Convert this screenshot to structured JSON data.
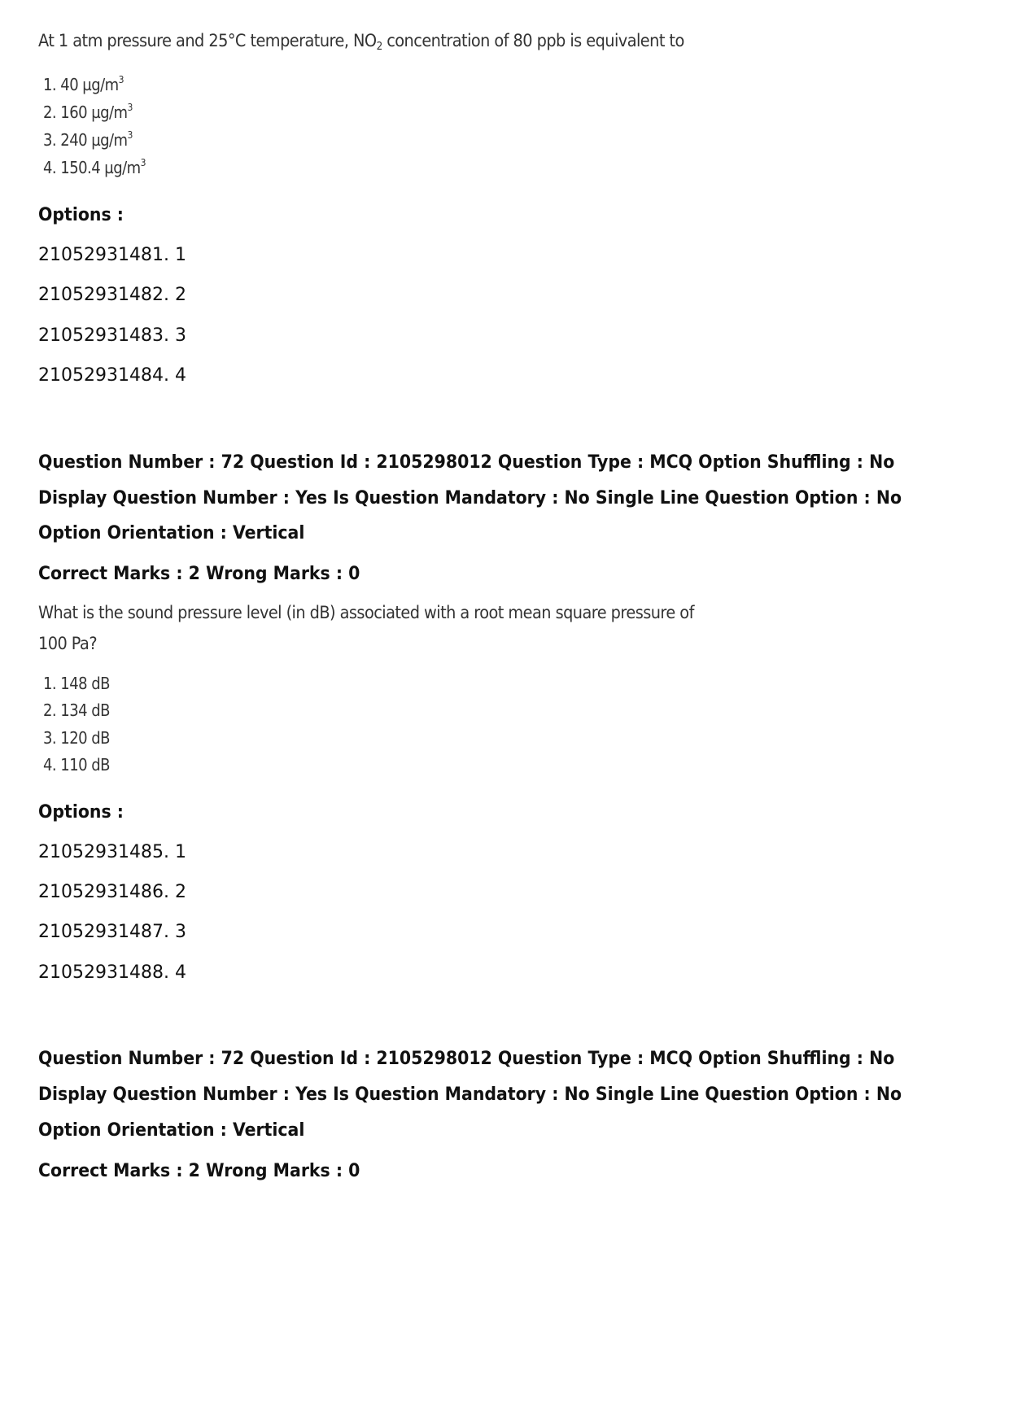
{
  "question_a": {
    "stem_prefix": "At 1 atm pressure and 25°C temperature, NO",
    "stem_sub": "2",
    "stem_suffix": " concentration of 80 ppb is equivalent to",
    "choices": [
      {
        "label": "1. 40 µg/m",
        "sup": "3"
      },
      {
        "label": "2. 160 µg/m",
        "sup": "3"
      },
      {
        "label": "3. 240 µg/m",
        "sup": "3"
      },
      {
        "label": "4. 150.4 µg/m",
        "sup": "3"
      }
    ],
    "options_heading": "Options :",
    "options": [
      "21052931481. 1",
      "21052931482. 2",
      "21052931483. 3",
      "21052931484. 4"
    ]
  },
  "question_b": {
    "meta_line1": "Question Number : 72 Question Id : 2105298012 Question Type : MCQ Option Shuffling : No",
    "meta_line2": "Display Question Number : Yes Is Question Mandatory : No Single Line Question Option : No",
    "meta_line3": "Option Orientation : Vertical",
    "marks": "Correct Marks : 2 Wrong Marks : 0",
    "stem": "What is the sound pressure level (in dB) associated with a root mean square pressure of 100 Pa?",
    "choices": [
      "1. 148 dB",
      "2. 134 dB",
      "3. 120 dB",
      "4. 110 dB"
    ],
    "options_heading": "Options :",
    "options": [
      "21052931485. 1",
      "21052931486. 2",
      "21052931487. 3",
      "21052931488. 4"
    ]
  },
  "question_c": {
    "meta_line1": "Question Number : 72 Question Id : 2105298012 Question Type : MCQ Option Shuffling : No",
    "meta_line2": "Display Question Number : Yes Is Question Mandatory : No Single Line Question Option : No",
    "meta_line3": "Option Orientation : Vertical",
    "marks": "Correct Marks : 2 Wrong Marks : 0"
  }
}
